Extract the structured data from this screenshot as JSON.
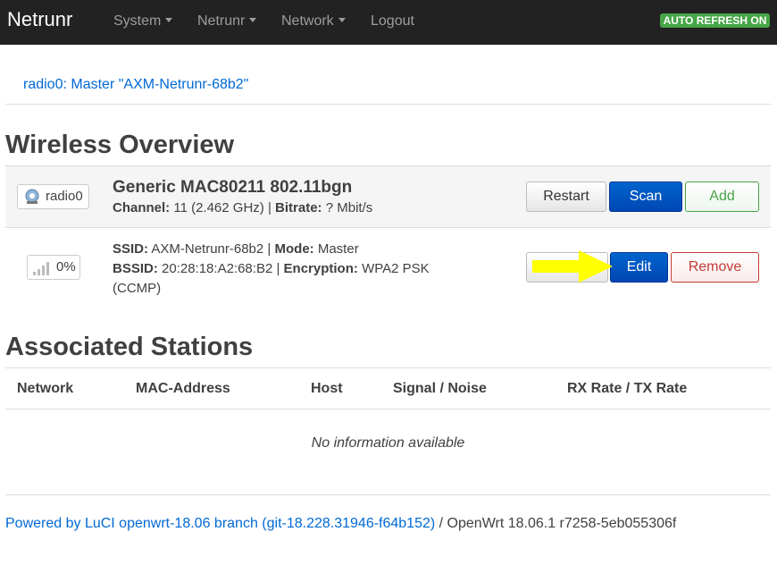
{
  "navbar": {
    "brand": "Netrunr",
    "menus": [
      {
        "label": "System",
        "has_caret": true
      },
      {
        "label": "Netrunr",
        "has_caret": true
      },
      {
        "label": "Network",
        "has_caret": true
      },
      {
        "label": "Logout",
        "has_caret": false
      }
    ],
    "auto_refresh": "AUTO REFRESH ON"
  },
  "tab": {
    "label": "radio0: Master \"AXM-Netrunr-68b2\""
  },
  "overview": {
    "heading": "Wireless Overview",
    "device": {
      "badge": "radio0",
      "badge_icon": "wifi-radio-icon",
      "title": "Generic MAC80211 802.11bgn",
      "channel_label": "Channel:",
      "channel_value": "11 (2.462 GHz)",
      "separator": "|",
      "bitrate_label": "Bitrate:",
      "bitrate_value": "? Mbit/s",
      "buttons": {
        "restart": "Restart",
        "scan": "Scan",
        "add": "Add"
      }
    },
    "network": {
      "signal_badge": "0%",
      "signal_icon": "signal-bars-icon",
      "ssid_label": "SSID:",
      "ssid_value": "AXM-Netrunr-68b2",
      "mode_label": "Mode:",
      "mode_value": "Master",
      "bssid_label": "BSSID:",
      "bssid_value": "20:28:18:A2:68:B2",
      "encryption_label": "Encryption:",
      "encryption_value": "WPA2 PSK",
      "encryption_extra": "(CCMP)",
      "separator": "|",
      "buttons": {
        "edit": "Edit",
        "remove": "Remove"
      }
    }
  },
  "stations": {
    "heading": "Associated Stations",
    "columns": [
      "Network",
      "MAC-Address",
      "Host",
      "Signal / Noise",
      "RX Rate / TX Rate"
    ],
    "empty_message": "No information available"
  },
  "footer": {
    "link_text": "Powered by LuCI openwrt-18.06 branch (git-18.228.31946-f64b152)",
    "suffix": "/ OpenWrt 18.06.1 r7258-5eb055306f"
  },
  "colors": {
    "navbar_bg": "#222222",
    "link": "#0069d6",
    "primary": "#0055cc",
    "success": "#46a546",
    "danger": "#c43c35",
    "annotation_arrow": "#ffff00"
  }
}
